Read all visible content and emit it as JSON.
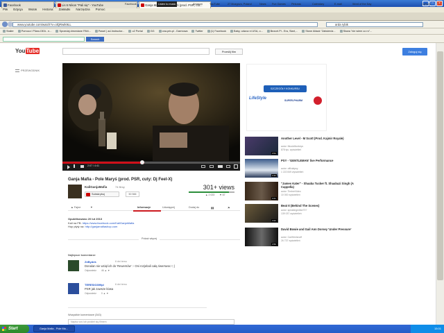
{
  "window": {
    "title": "Ganja Mafia - Pole Maryś (prod. PSR, cuty: Dj Feel-X) - YouTube - Mozilla Firefox"
  },
  "menu": [
    "Plik",
    "Edycja",
    "Widok",
    "Historia",
    "Zakładki",
    "Narzędzia",
    "Pomoc"
  ],
  "tabs": [
    {
      "label": "Facebook"
    },
    {
      "label": "Lis 6 Nikon \"Pali się\" - YouTube"
    },
    {
      "label": "Ganja Mafia - Pole Maryś (prod. PSR, cut..."
    }
  ],
  "address": {
    "url": "www.youtube.com/watch?v=olQRwIk9LL",
    "search_value": "arda rybik"
  },
  "bookmarks": [
    "Stailer",
    "Pomocz i Pilaro.DEA - n...",
    "Sprzedaj drewniane PAN...",
    "Pawel | ad-Instructor...",
    "o2 Portal",
    "GG",
    "ona.priv.pl - Darmowa",
    "Twitter",
    "(1) Facebook",
    "Baby, odwoz ni USA, o...",
    "Bezcel.Pl - Era, Start,...",
    "Stone Attack \"Zatwierdz...",
    "Słowa \"nie wiem co ro\"..."
  ],
  "toolbar2": {
    "search_placeholder": "",
    "search_button": "Search",
    "items": [
      "Facebook",
      "Listen to music",
      "Amazon",
      "YouTube",
      "27 Mozgovo, Poland",
      "News",
      "Fun Games",
      "Pinturas",
      "Calendary",
      "E-mail",
      "Word of the Day",
      "Options"
    ]
  },
  "youtube": {
    "logo_you": "You",
    "logo_tube": "Tube",
    "upload_label": "Prześlij film",
    "login_label": "Zaloguj się",
    "guide_label": "PRZEWODNIK"
  },
  "ad": {
    "button": "SZCZEGÓŁY KONKURSU",
    "brand_left": "LifeStyle",
    "brand_right": "SUPER-PHARM"
  },
  "player": {
    "time": "2:07 / 4:41"
  },
  "video": {
    "title": "Ganja Mafia - Pole Maryś (prod. PSR, cuty: Dj Feel-X)",
    "channel": "KaliGanjaMafia",
    "channel_videos": "74 filmy",
    "subscribe_label": "Subskrybuj",
    "subscribers": "50 566",
    "views": "301+ views",
    "likes": "2 023",
    "dislikes": "67",
    "like_label": "Fajne",
    "tabs": [
      "Informacje",
      "Udostępnij",
      "Dodaj do"
    ],
    "published": "Opublikowano 20 lut 2013",
    "desc_line1_prefix": "Kali na FB: ",
    "desc_line1_link": "https://www.facebook.com/KaliGanjaMafia",
    "desc_line2_prefix": "Hup płyty na: ",
    "desc_line2_link": "http://ganjamafiashop.com",
    "show_more": "Pokaż więcej"
  },
  "comments": {
    "heading": "Najlepsze komentarze",
    "items": [
      {
        "name": "ZeBydek",
        "time": "6 dni temu",
        "text": "Donalan nie wziął ich do 'Rewersów' :- Oni rozjebali całą riwerswoc !; )",
        "reply": "Odpowiedz",
        "score": "46"
      },
      {
        "name": "TERESIO399pl",
        "time": "6 dni temu",
        "text": "PSR jak zawsze klasa",
        "reply": "Odpowiedz",
        "score": "0"
      }
    ],
    "all_heading": "Wszystkie komentarze (343)",
    "input_placeholder": "Napisz coś lub podziel się filmem"
  },
  "sidebar": [
    {
      "title": "Another Level - M Scott (Prod. Kajmir Royale)",
      "channel": "autor: MusicMonkeys",
      "views": "878 tys. wyświetleń",
      "duration": "3:54"
    },
    {
      "title": "PSY - 'GENTLEMAN' live Performance",
      "channel": "autor: officialpsy",
      "views": "1 222 849 wyświetleń",
      "duration": "3:42"
    },
    {
      "title": "\"James Kater\" - Shaaba Tucker ft. Shaabazi Singh (A Cappella)",
      "channel": "autor: TimbreVideo",
      "views": "10 000 wyświetleń",
      "duration": "3:21"
    },
    {
      "title": "Beat It (Behind The Scenes)",
      "channel": "autor: speakingeditor70?",
      "views": "139 037 wyświetleń",
      "duration": "4:22"
    },
    {
      "title": "David Bowie and Gail Ann Dorsey 'Under Pressure'",
      "channel": "autor: CarlHenlsnoff",
      "views": "26 737 wyświetleń",
      "duration": "3:56"
    }
  ],
  "taskbar": {
    "start": "Start",
    "task": "Ganja Mafia - Pole Ma...",
    "clock": "15:01"
  }
}
